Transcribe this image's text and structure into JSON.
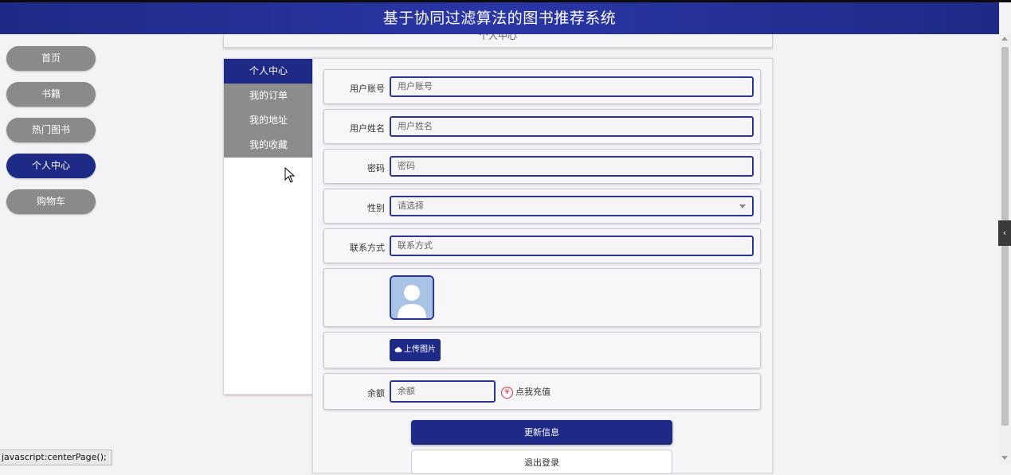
{
  "header": {
    "title": "基于协同过滤算法的图书推荐系统"
  },
  "nav": {
    "items": [
      {
        "label": "首页",
        "active": false
      },
      {
        "label": "书籍",
        "active": false
      },
      {
        "label": "热门图书",
        "active": false
      },
      {
        "label": "个人中心",
        "active": true
      },
      {
        "label": "购物车",
        "active": false
      }
    ]
  },
  "page": {
    "title": "个人中心"
  },
  "tabs": [
    {
      "label": "个人中心",
      "active": true
    },
    {
      "label": "我的订单",
      "active": false
    },
    {
      "label": "我的地址",
      "active": false
    },
    {
      "label": "我的收藏",
      "active": false
    }
  ],
  "form": {
    "account": {
      "label": "用户账号",
      "placeholder": "用户账号"
    },
    "name": {
      "label": "用户姓名",
      "placeholder": "用户姓名"
    },
    "password": {
      "label": "密码",
      "placeholder": "密码"
    },
    "gender": {
      "label": "性别",
      "selected": "请选择"
    },
    "contact": {
      "label": "联系方式",
      "placeholder": "联系方式"
    },
    "upload_label": "上传图片",
    "balance": {
      "label": "余额",
      "placeholder": "余额"
    },
    "recharge_label": "点我充值",
    "recharge_icon": "¥",
    "update_button": "更新信息",
    "logout_button": "退出登录"
  },
  "status_bar": {
    "text": "javascript:centerPage();"
  },
  "colors": {
    "primary": "#1f2a86",
    "nav_inactive": "#8a8a8a",
    "recharge": "#dd3333"
  }
}
